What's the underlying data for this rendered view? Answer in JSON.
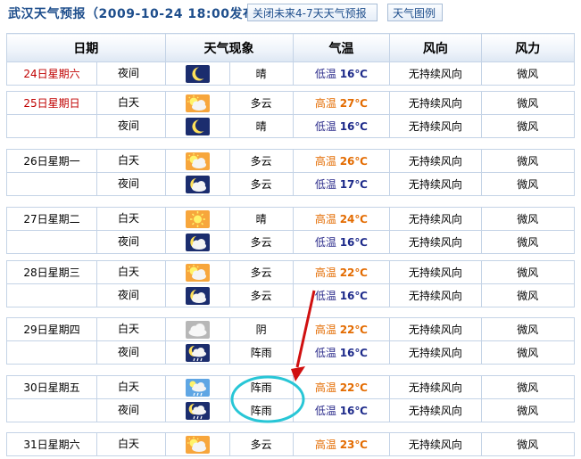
{
  "header": {
    "title": "武汉天气预报（2009-10-24 18:00发布）",
    "close_button": "关闭未来4-7天天气预报",
    "legend_button": "天气图例"
  },
  "columns": [
    "日期",
    "天气现象",
    "气温",
    "风向",
    "风力"
  ],
  "days": [
    {
      "date": "24日星期六",
      "rows": [
        {
          "period": "夜间",
          "icon": "moon-icon",
          "weather": "晴",
          "temp_label": "低温",
          "temp": "16℃",
          "wind_dir": "无持续风向",
          "wind_force": "微风"
        }
      ]
    },
    {
      "date": "25日星期日",
      "rows": [
        {
          "period": "白天",
          "icon": "sun-cloud-icon",
          "weather": "多云",
          "temp_label": "高温",
          "temp": "27℃",
          "wind_dir": "无持续风向",
          "wind_force": "微风"
        },
        {
          "period": "夜间",
          "icon": "moon-icon",
          "weather": "晴",
          "temp_label": "低温",
          "temp": "16℃",
          "wind_dir": "无持续风向",
          "wind_force": "微风"
        }
      ]
    },
    {
      "date": "26日星期一",
      "rows": [
        {
          "period": "白天",
          "icon": "sun-cloud-icon",
          "weather": "多云",
          "temp_label": "高温",
          "temp": "26℃",
          "wind_dir": "无持续风向",
          "wind_force": "微风"
        },
        {
          "period": "夜间",
          "icon": "moon-cloud-icon",
          "weather": "多云",
          "temp_label": "低温",
          "temp": "17℃",
          "wind_dir": "无持续风向",
          "wind_force": "微风"
        }
      ]
    },
    {
      "date": "27日星期二",
      "rows": [
        {
          "period": "白天",
          "icon": "sun-icon",
          "weather": "晴",
          "temp_label": "高温",
          "temp": "24℃",
          "wind_dir": "无持续风向",
          "wind_force": "微风"
        },
        {
          "period": "夜间",
          "icon": "moon-cloud-icon",
          "weather": "多云",
          "temp_label": "低温",
          "temp": "16℃",
          "wind_dir": "无持续风向",
          "wind_force": "微风"
        }
      ]
    },
    {
      "date": "28日星期三",
      "rows": [
        {
          "period": "白天",
          "icon": "sun-cloud-icon",
          "weather": "多云",
          "temp_label": "高温",
          "temp": "22℃",
          "wind_dir": "无持续风向",
          "wind_force": "微风"
        },
        {
          "period": "夜间",
          "icon": "moon-cloud-icon",
          "weather": "多云",
          "temp_label": "低温",
          "temp": "16℃",
          "wind_dir": "无持续风向",
          "wind_force": "微风"
        }
      ]
    },
    {
      "date": "29日星期四",
      "rows": [
        {
          "period": "白天",
          "icon": "overcast-icon",
          "weather": "阴",
          "temp_label": "高温",
          "temp": "22℃",
          "wind_dir": "无持续风向",
          "wind_force": "微风"
        },
        {
          "period": "夜间",
          "icon": "night-rain-icon",
          "weather": "阵雨",
          "temp_label": "低温",
          "temp": "16℃",
          "wind_dir": "无持续风向",
          "wind_force": "微风"
        }
      ]
    },
    {
      "date": "30日星期五",
      "rows": [
        {
          "period": "白天",
          "icon": "day-rain-icon",
          "weather": "阵雨",
          "temp_label": "高温",
          "temp": "22℃",
          "wind_dir": "无持续风向",
          "wind_force": "微风"
        },
        {
          "period": "夜间",
          "icon": "night-rain-icon",
          "weather": "阵雨",
          "temp_label": "低温",
          "temp": "16℃",
          "wind_dir": "无持续风向",
          "wind_force": "微风"
        }
      ]
    },
    {
      "date": "31日星期六",
      "rows": [
        {
          "period": "白天",
          "icon": "sun-cloud-icon",
          "weather": "多云",
          "temp_label": "高温",
          "temp": "23℃",
          "wind_dir": "无持续风向",
          "wind_force": "微风"
        }
      ]
    }
  ],
  "colors": {
    "title": "#1e4e8c",
    "weekend_date": "#c00000",
    "high_temp": "#e36b00",
    "low_temp": "#1d2a8a",
    "annotation": "#d01010",
    "highlight_ellipse": "#28c6d6"
  }
}
